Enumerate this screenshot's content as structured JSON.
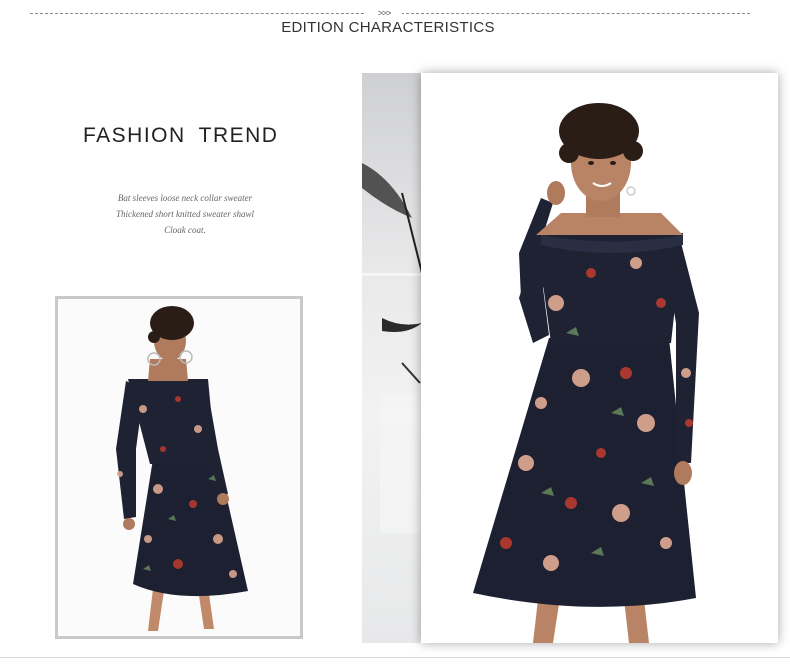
{
  "header": {
    "arrows": ">>>",
    "title": "EDITION CHARACTERISTICS"
  },
  "left_block": {
    "heading": "FASHION  TREND",
    "description": [
      "Bat sleeves loose neck collar sweater",
      "Thickened short knitted sweater shawl",
      "Cloak coat."
    ]
  },
  "photos": {
    "small": {
      "subject": "model in navy floral off-shoulder dress, full body"
    },
    "large": {
      "subject": "model in navy floral off-shoulder dress, hand at chin"
    }
  },
  "colors": {
    "dress_navy": "#1c2030",
    "floral_pink": "#d9a58f",
    "floral_red": "#b23a2f",
    "leaf_green": "#5f7d5a",
    "skin": "#b07a5c",
    "hair": "#2a1d16",
    "frame_grey": "#c9c9c9"
  }
}
